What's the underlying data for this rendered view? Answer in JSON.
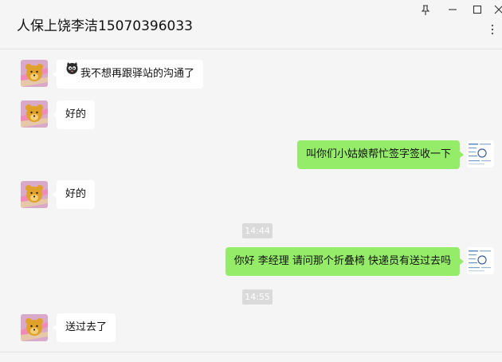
{
  "window": {
    "title": "人保上饶李洁15070396033",
    "controls": {
      "pin": "pin-icon",
      "minimize": "minimize-icon",
      "maximize": "maximize-icon",
      "close": "close-icon"
    },
    "more_icon": "more-dots-icon"
  },
  "messages": [
    {
      "side": "left",
      "text": "我不想再跟驿站的沟通了",
      "emoji": "cat-face-emoji"
    },
    {
      "side": "left",
      "text": "好的"
    },
    {
      "side": "right",
      "text": "叫你们小姑娘帮忙签字签收一下"
    },
    {
      "side": "left",
      "text": "好的"
    },
    {
      "time": "14:44"
    },
    {
      "side": "right",
      "text": "你好 李经理 请问那个折叠椅 快递员有送过去吗"
    },
    {
      "time": "14:55"
    },
    {
      "side": "left",
      "text": "送过去了"
    }
  ],
  "colors": {
    "self_bubble": "#95ec69",
    "other_bubble": "#ffffff",
    "background": "#f5f5f5",
    "time_badge": "#dadada"
  }
}
